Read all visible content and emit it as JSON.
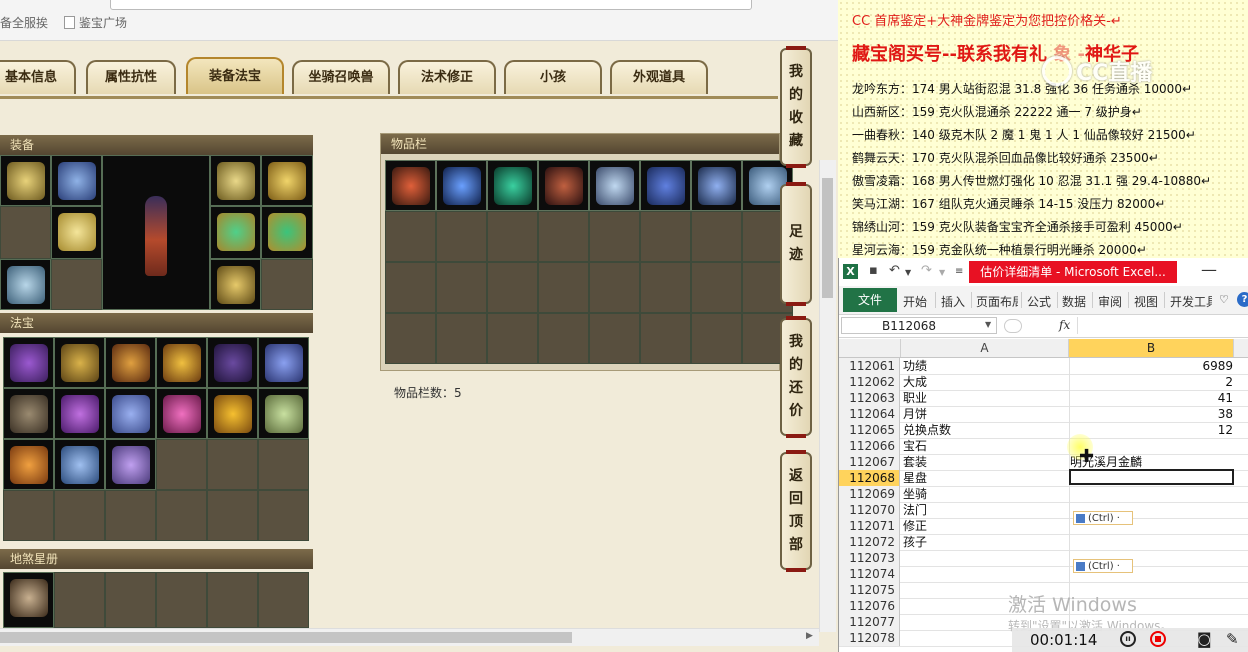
{
  "browser": {
    "bookmarks": [
      {
        "label": "备全服挨"
      },
      {
        "label": "鉴宝广场"
      }
    ]
  },
  "tabs": [
    {
      "label": "基本信息"
    },
    {
      "label": "属性抗性"
    },
    {
      "label": "装备法宝"
    },
    {
      "label": "坐骑召唤兽"
    },
    {
      "label": "法术修正"
    },
    {
      "label": "小孩"
    },
    {
      "label": "外观道具"
    }
  ],
  "sections": {
    "equipment": "装备",
    "treasures": "法宝",
    "stars": "地煞星册",
    "inventory": "物品栏",
    "inventory_count": "物品栏数：5"
  },
  "side_buttons": [
    {
      "chars": [
        "我",
        "的",
        "收",
        "藏"
      ]
    },
    {
      "chars": [
        "足",
        "迹"
      ]
    },
    {
      "chars": [
        "我",
        "的",
        "还",
        "价"
      ]
    },
    {
      "chars": [
        "返",
        "回",
        "顶",
        "部"
      ]
    }
  ],
  "doc": {
    "line1": "CC 首席鉴定+大神金牌鉴定为您把控价格关-↵",
    "line2": "藏宝阁买号--联系我有礼",
    "line2_tail": "神华子",
    "lines": [
      "龙吟东方：174 男人站街忍混 31.8 强化 36 任务通杀 10000↵",
      "山西新区：159 克火队混通杀 22222 通一 7 级护身↵",
      "一曲春秋：140 级克木队 2 魔 1 鬼 1 人 1 仙品像较好 21500↵",
      "鹤舞云天：170 克火队混杀回血品像比较好通杀 23500↵",
      "傲雪凌霜：168 男人传世燃灯强化 10 忍混 31.1 强 29.4-10880↵",
      "笑马江湖：167 组队克火通灵睡杀 14-15 没压力 82000↵",
      "锦绣山河：159 克火队装备宝宝齐全通杀接手可盈利 45000↵",
      "星河云海：159 克金队统一种植景行明光睡杀 20000↵"
    ],
    "watermark": "CC直播"
  },
  "excel": {
    "logo": "X",
    "caption": "估价详细清单 - Microsoft Excel...",
    "file_tab": "文件",
    "ribbon_tabs": [
      "开始",
      "插入",
      "页面布局",
      "公式",
      "数据",
      "审阅",
      "视图",
      "开发工具"
    ],
    "name_box": "B112068",
    "fx": "fx",
    "columns": [
      "A",
      "B"
    ],
    "rows": [
      {
        "n": "112061",
        "a": "功绩",
        "b": "6989"
      },
      {
        "n": "112062",
        "a": "大成",
        "b": "2"
      },
      {
        "n": "112063",
        "a": "职业",
        "b": "41"
      },
      {
        "n": "112064",
        "a": "月饼",
        "b": "38"
      },
      {
        "n": "112065",
        "a": "兑换点数",
        "b": "12"
      },
      {
        "n": "112066",
        "a": "宝石",
        "b": ""
      },
      {
        "n": "112067",
        "a": "套装",
        "b": "明光溪月金麟"
      },
      {
        "n": "112068",
        "a": "星盘",
        "b": ""
      },
      {
        "n": "112069",
        "a": "坐骑",
        "b": ""
      },
      {
        "n": "112070",
        "a": "法门",
        "b": ""
      },
      {
        "n": "112071",
        "a": "修正",
        "b": ""
      },
      {
        "n": "112072",
        "a": "孩子",
        "b": ""
      },
      {
        "n": "112073",
        "a": "",
        "b": ""
      },
      {
        "n": "112074",
        "a": "",
        "b": ""
      },
      {
        "n": "112075",
        "a": "",
        "b": ""
      },
      {
        "n": "112076",
        "a": "",
        "b": ""
      },
      {
        "n": "112077",
        "a": "",
        "b": ""
      },
      {
        "n": "112078",
        "a": "",
        "b": ""
      }
    ],
    "paste_label": "(Ctrl) ·"
  },
  "overlay": {
    "activate_title": "激活 Windows",
    "activate_sub": "转到\"设置\"以激活 Windows。",
    "timer": "00:01:14"
  },
  "colors": {
    "doc_red": "#e01814",
    "excel_green": "#217346",
    "excel_red_caption": "#e81123",
    "selection_gold": "#ffd35c"
  }
}
